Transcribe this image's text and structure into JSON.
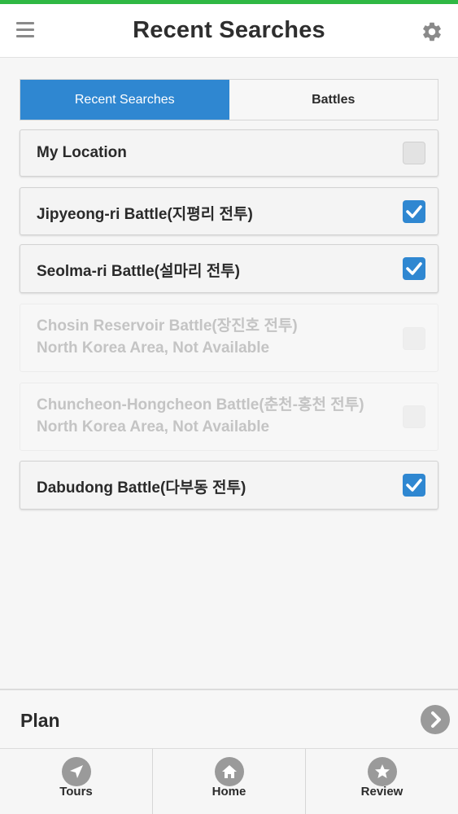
{
  "header": {
    "title": "Recent Searches",
    "menu_icon": "hamburger-menu-icon",
    "settings_icon": "gear-icon"
  },
  "tabs": [
    {
      "label": "Recent Searches",
      "active": true
    },
    {
      "label": "Battles",
      "active": false
    }
  ],
  "items": [
    {
      "line1": "My Location",
      "checked": false,
      "enabled": true
    },
    {
      "line1": "Jipyeong-ri Battle(지평리 전투)",
      "checked": true,
      "enabled": true
    },
    {
      "line1": "Seolma-ri Battle(설마리 전투)",
      "checked": true,
      "enabled": true
    },
    {
      "line1": "Chosin Reservoir Battle(장진호 전투)",
      "line2": "North Korea Area, Not Available",
      "checked": false,
      "enabled": false
    },
    {
      "line1": "Chuncheon-Hongcheon Battle(춘천-홍천 전투)",
      "line2": "North Korea Area, Not Available",
      "checked": false,
      "enabled": false
    },
    {
      "line1": "Dabudong Battle(다부동 전투)",
      "checked": true,
      "enabled": true
    }
  ],
  "plan": {
    "label": "Plan",
    "icon": "chevron-right-icon"
  },
  "bottom_nav": [
    {
      "label": "Tours",
      "icon": "navigation-arrow-icon"
    },
    {
      "label": "Home",
      "icon": "home-icon"
    },
    {
      "label": "Review",
      "icon": "star-icon"
    }
  ],
  "colors": {
    "accent": "#2f87d1",
    "top_bar": "#2fb844",
    "icon_gray": "#9a9a9a"
  }
}
